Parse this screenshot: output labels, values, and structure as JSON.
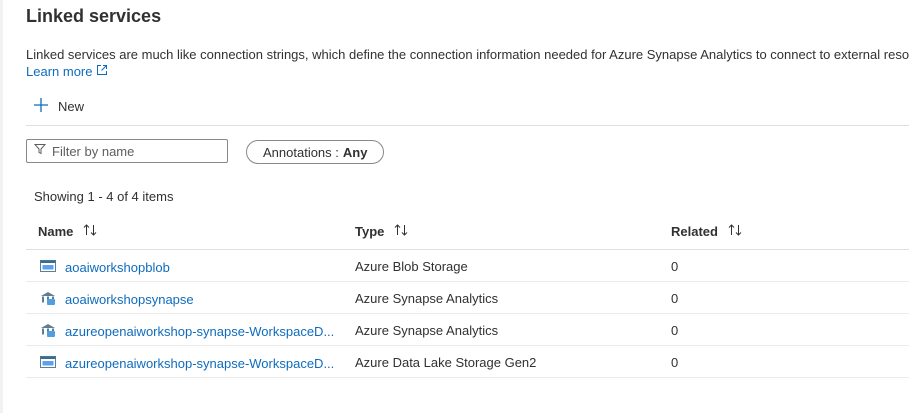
{
  "page": {
    "title": "Linked services",
    "description": "Linked services are much like connection strings, which define the connection information needed for Azure Synapse Analytics to connect to external resou",
    "learn_more": "Learn more"
  },
  "toolbar": {
    "new_label": "New"
  },
  "filter": {
    "placeholder": "Filter by name"
  },
  "annotations": {
    "label": "Annotations :",
    "value": "Any"
  },
  "showing": "Showing 1 - 4 of 4 items",
  "table": {
    "columns": [
      "Name",
      "Type",
      "Related"
    ],
    "rows": [
      {
        "name": "aoaiworkshopblob",
        "type": "Azure Blob Storage",
        "related": "0",
        "icon": "blob-storage-icon"
      },
      {
        "name": "aoaiworkshopsynapse",
        "type": "Azure Synapse Analytics",
        "related": "0",
        "icon": "synapse-icon"
      },
      {
        "name": "azureopenaiworkshop-synapse-WorkspaceD...",
        "type": "Azure Synapse Analytics",
        "related": "0",
        "icon": "synapse-icon"
      },
      {
        "name": "azureopenaiworkshop-synapse-WorkspaceD...",
        "type": "Azure Data Lake Storage Gen2",
        "related": "0",
        "icon": "data-lake-storage-icon"
      }
    ]
  },
  "colors": {
    "link": "#0f6cbd",
    "text": "#323130",
    "border": "#8a8886"
  }
}
